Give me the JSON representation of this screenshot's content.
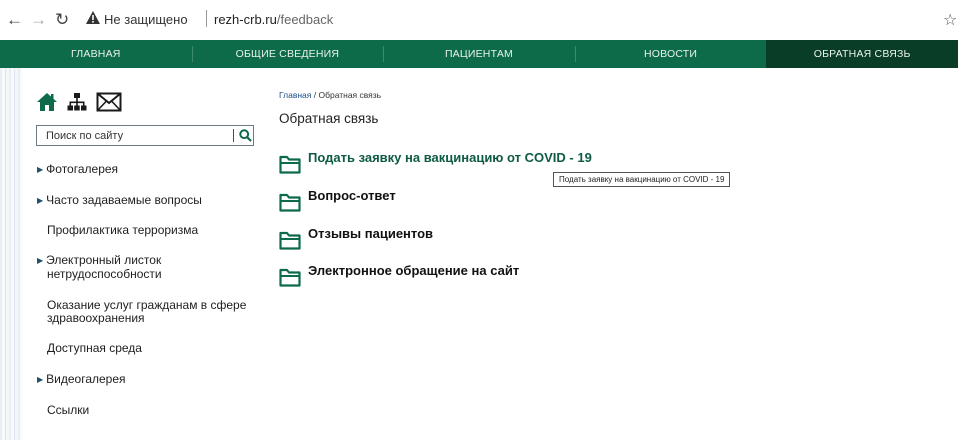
{
  "browser": {
    "security_label": "Не защищено",
    "url_host": "rezh-crb.ru",
    "url_path": "/feedback"
  },
  "navbar": {
    "items": [
      {
        "label": "ГЛАВНАЯ"
      },
      {
        "label": "ОБЩИЕ СВЕДЕНИЯ"
      },
      {
        "label": "ПАЦИЕНТАМ"
      },
      {
        "label": "НОВОСТИ"
      },
      {
        "label": "ОБРАТНАЯ СВЯЗЬ"
      }
    ],
    "active_index": 4
  },
  "sidebar": {
    "search_placeholder": "Поиск по сайту",
    "items": [
      {
        "label": "Фотогалерея",
        "has_arrow": true
      },
      {
        "label": "Часто задаваемые вопросы",
        "has_arrow": true
      },
      {
        "label": "Профилактика терроризма",
        "has_arrow": false
      },
      {
        "label_line1": "Электронный листок",
        "label_line2": "нетрудоспособности",
        "has_arrow": true
      },
      {
        "label_line1": "Оказание услуг гражданам в сфере",
        "label_line2": "здравоохранения",
        "has_arrow": false
      },
      {
        "label": "Доступная среда",
        "has_arrow": false
      },
      {
        "label": "Видеогалерея",
        "has_arrow": true
      },
      {
        "label": "Ссылки",
        "has_arrow": false
      }
    ]
  },
  "main": {
    "breadcrumb": {
      "home": "Главная",
      "separator": "/",
      "current": "Обратная связь"
    },
    "title": "Обратная связь",
    "folders": [
      {
        "label": "Подать заявку на вакцинацию от COVID - 19"
      },
      {
        "label": "Вопрос-ответ"
      },
      {
        "label": "Отзывы пациентов"
      },
      {
        "label": "Электронное обращение на сайт"
      }
    ],
    "tooltip": "Подать заявку на вакцинацию от  COVID - 19"
  },
  "colors": {
    "nav_green": "#0e6b4a",
    "nav_active": "#0a3d28",
    "icon_green": "#0e6b4a"
  }
}
